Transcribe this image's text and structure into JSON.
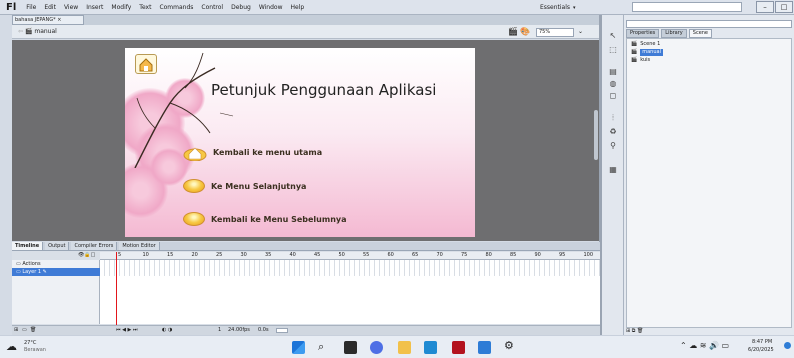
{
  "app": {
    "logo": "Fl"
  },
  "menu": {
    "items": [
      "File",
      "Edit",
      "View",
      "Insert",
      "Modify",
      "Text",
      "Commands",
      "Control",
      "Debug",
      "Window",
      "Help"
    ]
  },
  "workspace": {
    "label": "Essentials",
    "search_placeholder": "🔍"
  },
  "document": {
    "tab_label": "bahasa JEPANG*",
    "scene_name": "manual",
    "zoom": "75%"
  },
  "stage": {
    "title": "Petunjuk Penggunaan Aplikasi",
    "nav_items": [
      {
        "label": "Kembali ke menu utama",
        "icon": "home-icon"
      },
      {
        "label": "Ke Menu Selanjutnya",
        "icon": "gold-button-icon"
      },
      {
        "label": "Kembali ke Menu Sebelumnya",
        "icon": "gold-button-icon"
      }
    ],
    "colors": {
      "pink": "#f4b9d2",
      "gold": "#f7c843"
    }
  },
  "panel": {
    "tabs": [
      "Properties",
      "Library",
      "Scene"
    ],
    "active_tab": "Scene",
    "scenes": [
      "Scene 1",
      "manual",
      "kuis"
    ],
    "selected_scene": "manual"
  },
  "timeline": {
    "tabs": [
      "Timeline",
      "Output",
      "Compiler Errors",
      "Motion Editor"
    ],
    "active_tab": "Timeline",
    "ruler": [
      "5",
      "10",
      "15",
      "20",
      "25",
      "30",
      "35",
      "40",
      "45",
      "50",
      "55",
      "60",
      "65",
      "70",
      "75",
      "80",
      "85",
      "90",
      "95",
      "100"
    ],
    "layers": [
      {
        "name": "Actions"
      },
      {
        "name": "Layer 1"
      }
    ],
    "selected_layer": "Layer 1",
    "footer": {
      "fps": "24.00fps",
      "time": "0.0s",
      "frame": "1"
    }
  },
  "taskbar": {
    "weather_temp": "27°C",
    "weather_desc": "Berawan",
    "time": "8:47 PM",
    "date": "6/20/2025"
  }
}
